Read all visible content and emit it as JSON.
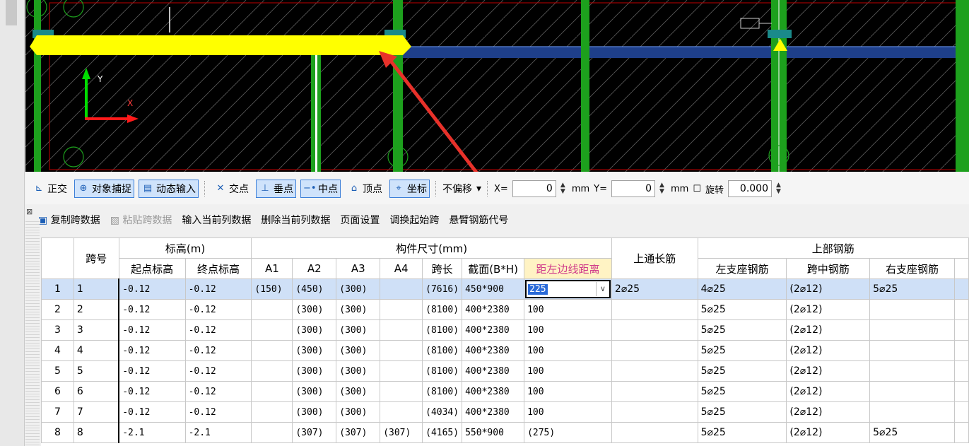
{
  "toolbar1": {
    "ortho_label": "正交",
    "snap_label": "对象捕捉",
    "dyn_input_label": "动态输入",
    "intersect_label": "交点",
    "perp_label": "垂点",
    "mid_label": "中点",
    "vertex_label": "顶点",
    "coord_label": "坐标",
    "offset_value": "不偏移",
    "x_label": "X=",
    "x_value": "0",
    "mm1": "mm",
    "y_label": "Y=",
    "y_value": "0",
    "mm2": "mm",
    "rotate_label": "旋转",
    "rotate_value": "0.000"
  },
  "toolbar2": {
    "copy_span": "复制跨数据",
    "paste_span": "粘贴跨数据",
    "input_col": "输入当前列数据",
    "delete_col": "删除当前列数据",
    "page_setup": "页面设置",
    "swap_start": "调换起始跨",
    "cantilever": "悬臂钢筋代号"
  },
  "table": {
    "h_span": "跨号",
    "h_elev": "标高(m)",
    "h_elev_start": "起点标高",
    "h_elev_end": "终点标高",
    "h_dims": "构件尺寸(mm)",
    "h_a1": "A1",
    "h_a2": "A2",
    "h_a3": "A3",
    "h_a4": "A4",
    "h_len": "跨长",
    "h_section": "截面(B*H)",
    "h_edge": "距左边线距离",
    "h_top_cont": "上通长筋",
    "h_top_bars": "上部钢筋",
    "h_left_sup": "左支座钢筋",
    "h_mid": "跨中钢筋",
    "h_right_sup": "右支座钢筋",
    "rows": [
      {
        "n": "1",
        "span": "1",
        "es": "-0.12",
        "ee": "-0.12",
        "a1": "(150)",
        "a2": "(450)",
        "a3": "(300)",
        "a4": "",
        "len": "(7616)",
        "sec": "450*900",
        "edge": "225",
        "top": "2⌀25",
        "ls": "4⌀25",
        "mid": "(2⌀12)",
        "rs": "5⌀25"
      },
      {
        "n": "2",
        "span": "2",
        "es": "-0.12",
        "ee": "-0.12",
        "a1": "",
        "a2": "(300)",
        "a3": "(300)",
        "a4": "",
        "len": "(8100)",
        "sec": "400*2380",
        "edge": "100",
        "top": "",
        "ls": "5⌀25",
        "mid": "(2⌀12)",
        "rs": ""
      },
      {
        "n": "3",
        "span": "3",
        "es": "-0.12",
        "ee": "-0.12",
        "a1": "",
        "a2": "(300)",
        "a3": "(300)",
        "a4": "",
        "len": "(8100)",
        "sec": "400*2380",
        "edge": "100",
        "top": "",
        "ls": "5⌀25",
        "mid": "(2⌀12)",
        "rs": ""
      },
      {
        "n": "4",
        "span": "4",
        "es": "-0.12",
        "ee": "-0.12",
        "a1": "",
        "a2": "(300)",
        "a3": "(300)",
        "a4": "",
        "len": "(8100)",
        "sec": "400*2380",
        "edge": "100",
        "top": "",
        "ls": "5⌀25",
        "mid": "(2⌀12)",
        "rs": ""
      },
      {
        "n": "5",
        "span": "5",
        "es": "-0.12",
        "ee": "-0.12",
        "a1": "",
        "a2": "(300)",
        "a3": "(300)",
        "a4": "",
        "len": "(8100)",
        "sec": "400*2380",
        "edge": "100",
        "top": "",
        "ls": "5⌀25",
        "mid": "(2⌀12)",
        "rs": ""
      },
      {
        "n": "6",
        "span": "6",
        "es": "-0.12",
        "ee": "-0.12",
        "a1": "",
        "a2": "(300)",
        "a3": "(300)",
        "a4": "",
        "len": "(8100)",
        "sec": "400*2380",
        "edge": "100",
        "top": "",
        "ls": "5⌀25",
        "mid": "(2⌀12)",
        "rs": ""
      },
      {
        "n": "7",
        "span": "7",
        "es": "-0.12",
        "ee": "-0.12",
        "a1": "",
        "a2": "(300)",
        "a3": "(300)",
        "a4": "",
        "len": "(4034)",
        "sec": "400*2380",
        "edge": "100",
        "top": "",
        "ls": "5⌀25",
        "mid": "(2⌀12)",
        "rs": ""
      },
      {
        "n": "8",
        "span": "8",
        "es": "-2.1",
        "ee": "-2.1",
        "a1": "",
        "a2": "(307)",
        "a3": "(307)",
        "a4": "(307)",
        "len": "(4165)",
        "sec": "550*900",
        "edge": "(275)",
        "top": "",
        "ls": "5⌀25",
        "mid": "(2⌀12)",
        "rs": "5⌀25"
      }
    ]
  },
  "colors": {
    "highlight_beam": "#ffff00",
    "annotation_arrow": "#e8312a",
    "selected_row": "#cfe0f7",
    "edit_header": "#d03a8a"
  }
}
